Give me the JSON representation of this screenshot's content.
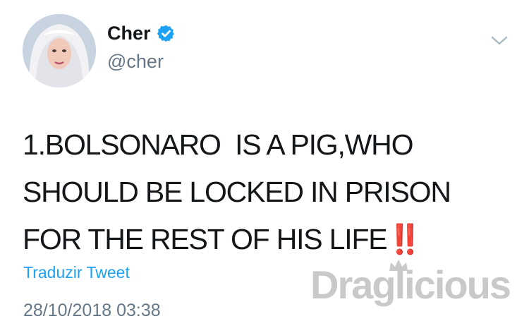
{
  "tweet": {
    "display_name": "Cher",
    "handle": "@cher",
    "text_main": "1.BOLSONARO  IS A PIG,WHO SHOULD BE LOCKED IN PRISON FOR THE REST OF HIS LIFE",
    "text_emoji": "‼️",
    "translate_label": "Traduzir Tweet",
    "timestamp": "28/10/2018 03:38"
  },
  "watermark": {
    "text": "Draglicious"
  },
  "icons": {
    "verified": "verified-badge-icon",
    "chevron": "chevron-down-icon"
  },
  "colors": {
    "verified_blue": "#1da1f2",
    "link_blue": "#1da1f2",
    "muted_gray": "#657786",
    "emoji_red": "#e0245e",
    "watermark_gray": "#c9c9c9"
  }
}
